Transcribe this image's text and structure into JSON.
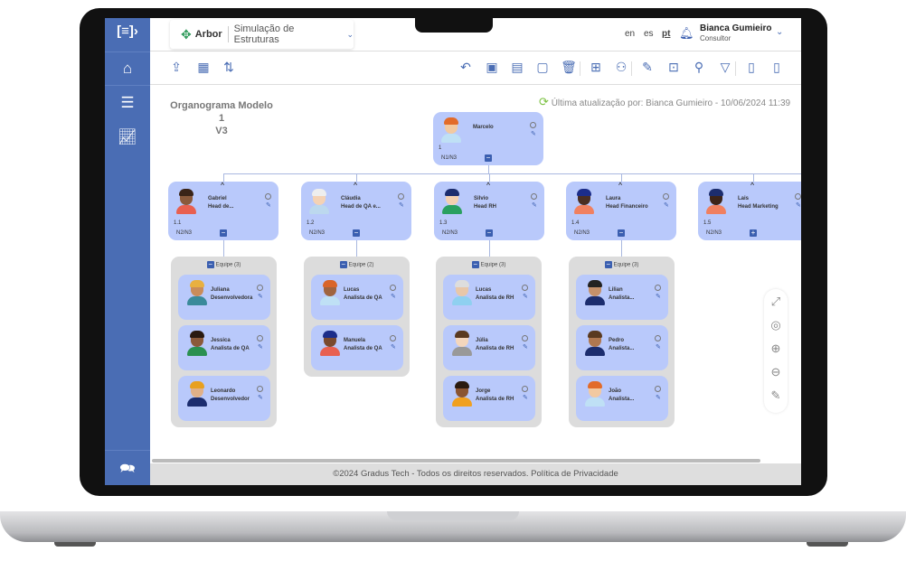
{
  "colors": {
    "sidebar": "#4a6db4",
    "node": "#b9c9fb",
    "team": "#dcdcdc",
    "accent": "#3b5fb0",
    "sync": "#7cc142"
  },
  "header": {
    "logo_icon": "arbor-tree-icon",
    "app": "Arbor",
    "module": "Simulação de Estruturas",
    "languages": [
      "en",
      "es",
      "pt"
    ],
    "active_language": "pt",
    "user_name": "Bianca Gumieiro",
    "user_role": "Consultor"
  },
  "sidebar": {
    "items": [
      {
        "icon": "home-icon"
      },
      {
        "icon": "sliders-icon"
      },
      {
        "icon": "chart-icon"
      },
      {
        "icon": "help-chat-icon"
      }
    ]
  },
  "toolbar": {
    "left": [
      "cloud-upload-icon",
      "grid-icon",
      "swap-icon"
    ],
    "right": [
      "undo-icon",
      "person-card-icon",
      "export-icon",
      "save-icon",
      "trash-icon",
      "table-icon",
      "hierarchy-icon",
      "edit-icon",
      "file-add-icon",
      "search-icon",
      "filter-icon",
      "image-file-icon",
      "pdf-file-icon"
    ]
  },
  "chart_title": "Organograma Modelo 1",
  "version": "V3",
  "last_update": "Última atualização por: Bianca Gumieiro - 10/06/2024 11:39",
  "root": {
    "name": "Marcelo",
    "role": "",
    "number": "1",
    "level": "N1/N3",
    "expander": "−"
  },
  "heads": [
    {
      "name": "Gabriel",
      "role": "Head de...",
      "number": "1.1",
      "level": "N2/N3",
      "expander": "−"
    },
    {
      "name": "Cláudia",
      "role": "Head de QA e...",
      "number": "1.2",
      "level": "N2/N3",
      "expander": "−"
    },
    {
      "name": "Silvio",
      "role": "Head RH",
      "number": "1.3",
      "level": "N2/N3",
      "expander": "−"
    },
    {
      "name": "Laura",
      "role": "Head Financeiro",
      "number": "1.4",
      "level": "N2/N3",
      "expander": "−"
    },
    {
      "name": "Lais",
      "role": "Head Marketing",
      "number": "1.5",
      "level": "N2/N3",
      "expander": "+"
    }
  ],
  "teams": [
    {
      "label": "Equipe (3)",
      "members": [
        {
          "name": "Juliana",
          "role": "Desenvolvedora"
        },
        {
          "name": "Jessica",
          "role": "Analista de QA"
        },
        {
          "name": "Leonardo",
          "role": "Desenvolvedor"
        }
      ]
    },
    {
      "label": "Equipe (2)",
      "members": [
        {
          "name": "Lucas",
          "role": "Analista de QA"
        },
        {
          "name": "Manuela",
          "role": "Analista de QA"
        }
      ]
    },
    {
      "label": "Equipe (3)",
      "members": [
        {
          "name": "Lucas",
          "role": "Analista de RH"
        },
        {
          "name": "Júlia",
          "role": "Analista de RH"
        },
        {
          "name": "Jorge",
          "role": "Analista de RH"
        }
      ]
    },
    {
      "label": "Equipe (3)",
      "members": [
        {
          "name": "Lilian",
          "role": "Analista..."
        },
        {
          "name": "Pedro",
          "role": "Analista..."
        },
        {
          "name": "João",
          "role": "Analista..."
        }
      ]
    }
  ],
  "zoom_controls": [
    "fullscreen-icon",
    "center-target-icon",
    "zoom-in-icon",
    "zoom-out-icon",
    "pencil-icon"
  ],
  "footer": "©2024 Gradus Tech - Todos os direitos reservados. Política de Privacidade"
}
